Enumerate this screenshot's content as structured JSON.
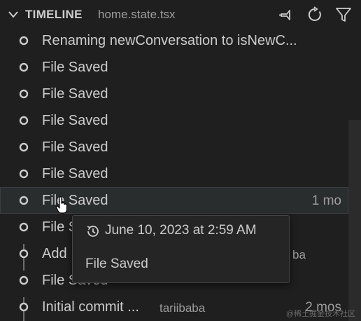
{
  "header": {
    "title": "TIMELINE",
    "file": "home.state.tsx",
    "icons": [
      "chevron-down-icon",
      "pin-icon",
      "refresh-icon",
      "filter-icon"
    ]
  },
  "items": [
    {
      "label": "Renaming newConversation to isNewC...",
      "kind": "file"
    },
    {
      "label": "File Saved",
      "kind": "file"
    },
    {
      "label": "File Saved",
      "kind": "file"
    },
    {
      "label": "File Saved",
      "kind": "file"
    },
    {
      "label": "File Saved",
      "kind": "file"
    },
    {
      "label": "File Saved",
      "kind": "file"
    },
    {
      "label": "File Saved",
      "kind": "file",
      "time": "1 mo",
      "hovered": true
    },
    {
      "label": "File S",
      "kind": "file"
    },
    {
      "label": "Add",
      "kind": "commit",
      "author": "ba"
    },
    {
      "label": "File Saved",
      "kind": "file"
    },
    {
      "label": "Initial commit ...",
      "kind": "commit",
      "author": "tariibaba",
      "time": "2 mos"
    }
  ],
  "tooltip": {
    "date": "June 10, 2023 at 2:59 AM",
    "message": "File Saved",
    "icon": "history-icon"
  },
  "watermark": "@稀土掘金技术社区",
  "colors": {
    "background": "#1f1f1f",
    "hover_row": "#2a2d2e",
    "text": "#cccccc",
    "muted": "#9d9d9d"
  }
}
